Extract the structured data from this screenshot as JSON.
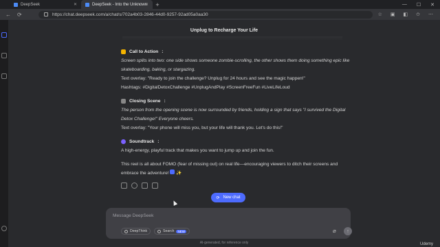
{
  "browser": {
    "tabs": [
      {
        "label": "DeepSeek"
      },
      {
        "label": "DeepSeek - Into the Unknown"
      }
    ],
    "url": "https://chat.deepseek.com/a/chat/s/702a4b03-2846-44d0-9257-92ad05a0aa30"
  },
  "chat": {
    "title": "Unplug to Recharge Your Life",
    "sections": [
      {
        "heading": "Call to Action",
        "emoji_color": "#f4b400",
        "lines": [
          {
            "text": "Screen splits into two: one side shows someone zombie-scrolling, the other shows them doing something epic like skateboarding, baking, or stargazing.",
            "italic": true
          },
          {
            "text": "Text overlay: \"Ready to join the challenge? Unplug for 24 hours and see the magic happen!\"",
            "italic": false
          },
          {
            "text": "Hashtags: #DigitalDetoxChallenge #UnplugAndPlay #ScreenFreeFun #LiveLifeLoud",
            "italic": false
          }
        ]
      },
      {
        "heading": "Closing Scene",
        "emoji_color": "#888888",
        "lines": [
          {
            "text": "The person from the opening scene is now surrounded by friends, holding a sign that says \"I survived the Digital Detox Challenge!\" Everyone cheers.",
            "italic": true
          },
          {
            "text": "Text overlay: \"Your phone will miss you, but your life will thank you. Let's do this!\"",
            "italic": false
          }
        ]
      },
      {
        "heading": "Soundtrack",
        "emoji_color": "#7b61ff",
        "lines": [
          {
            "text": "A high-energy, playful track that makes you want to jump up and join the fun.",
            "italic": false
          }
        ]
      }
    ],
    "closing": "This reel is all about FOMO (fear of missing out) on real life—encouraging viewers to ditch their screens and embrace the adventure! ",
    "new_chat_label": "New chat",
    "composer": {
      "placeholder": "Message DeepSeek",
      "deepthink_label": "DeepThink",
      "search_label": "Search",
      "search_badge": "NEW"
    },
    "footnote": "AI-generated, for reference only"
  },
  "watermark": "Udemy"
}
